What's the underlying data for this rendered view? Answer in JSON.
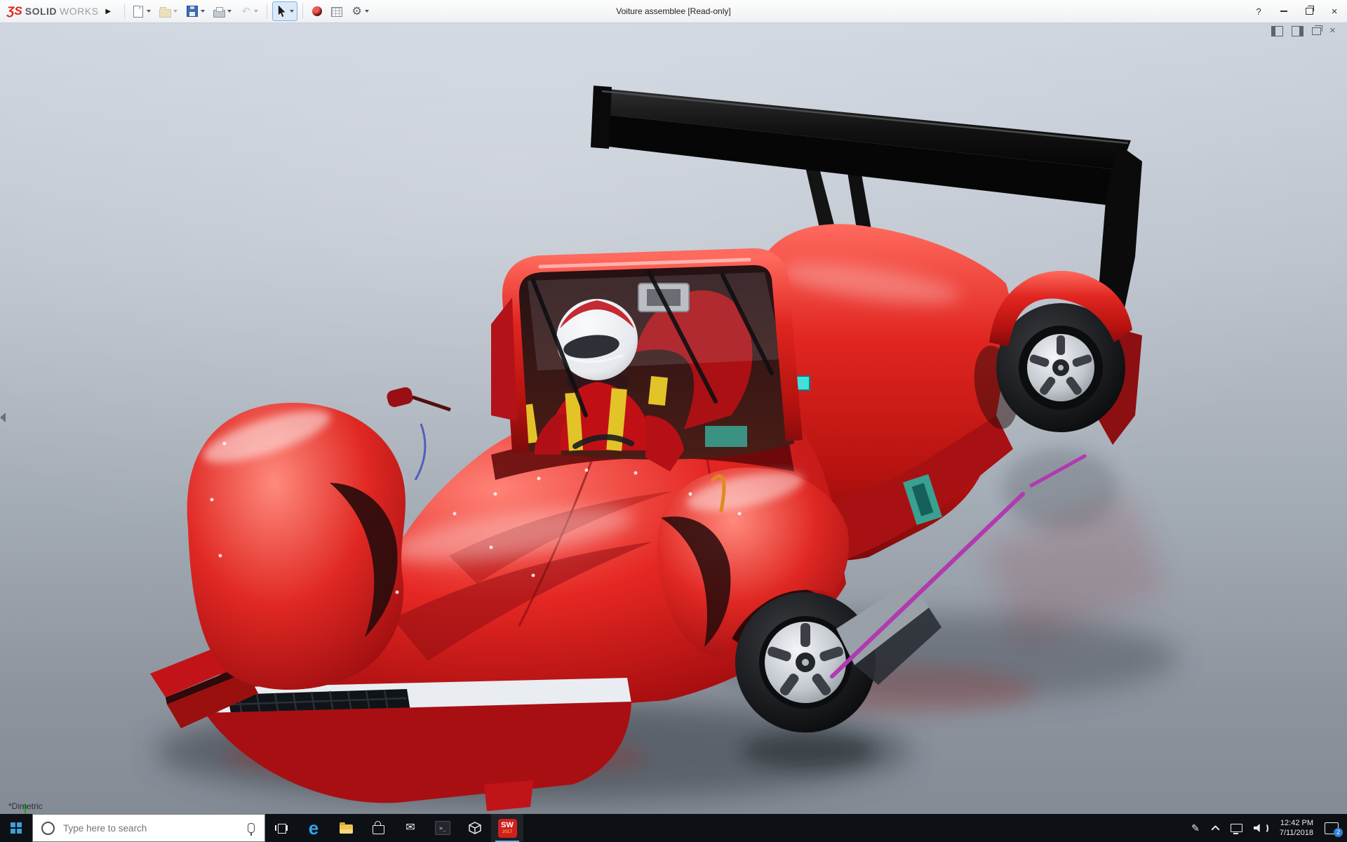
{
  "window": {
    "brand_mark": "ƷS",
    "brand_primary": "SOLID",
    "brand_secondary": "WORKS",
    "menu_expand_glyph": "▶",
    "title": "Voiture assemblee [Read-only]",
    "help_glyph": "?",
    "close_glyph": "×",
    "toolbar_items": [
      "new-document",
      "open",
      "save",
      "print",
      "undo",
      "select",
      "appearances",
      "design-table",
      "options"
    ]
  },
  "viewport": {
    "view_label": "*Dimetric",
    "document_controls": [
      "pane-left",
      "pane-right",
      "restore-document",
      "close-document"
    ]
  },
  "taskbar": {
    "search_placeholder": "Type here to search",
    "edge_glyph": "e",
    "console_glyph": ">_",
    "solidworks_label": "SW",
    "solidworks_year": "2017",
    "clock_time": "12:42 PM",
    "clock_date": "7/11/2018",
    "notification_count": "2",
    "apps": [
      "start",
      "search",
      "task-view",
      "edge",
      "file-explorer",
      "store",
      "mail",
      "console",
      "3d-viewer",
      "solidworks-2017"
    ],
    "tray": [
      "pen",
      "hidden-icons",
      "network",
      "volume",
      "clock",
      "notifications"
    ]
  },
  "colors": {
    "car_red": "#d81a1a",
    "wing_black": "#0d0d0d",
    "viewport_top": "#cdd4de",
    "viewport_bottom": "#848b95",
    "taskbar_bg": "#0d1116",
    "accent_blue": "#3f9fd8",
    "magenta_accent": "#b03ab0",
    "teal_accent": "#3aa08f",
    "harness_yellow": "#e2c428"
  }
}
